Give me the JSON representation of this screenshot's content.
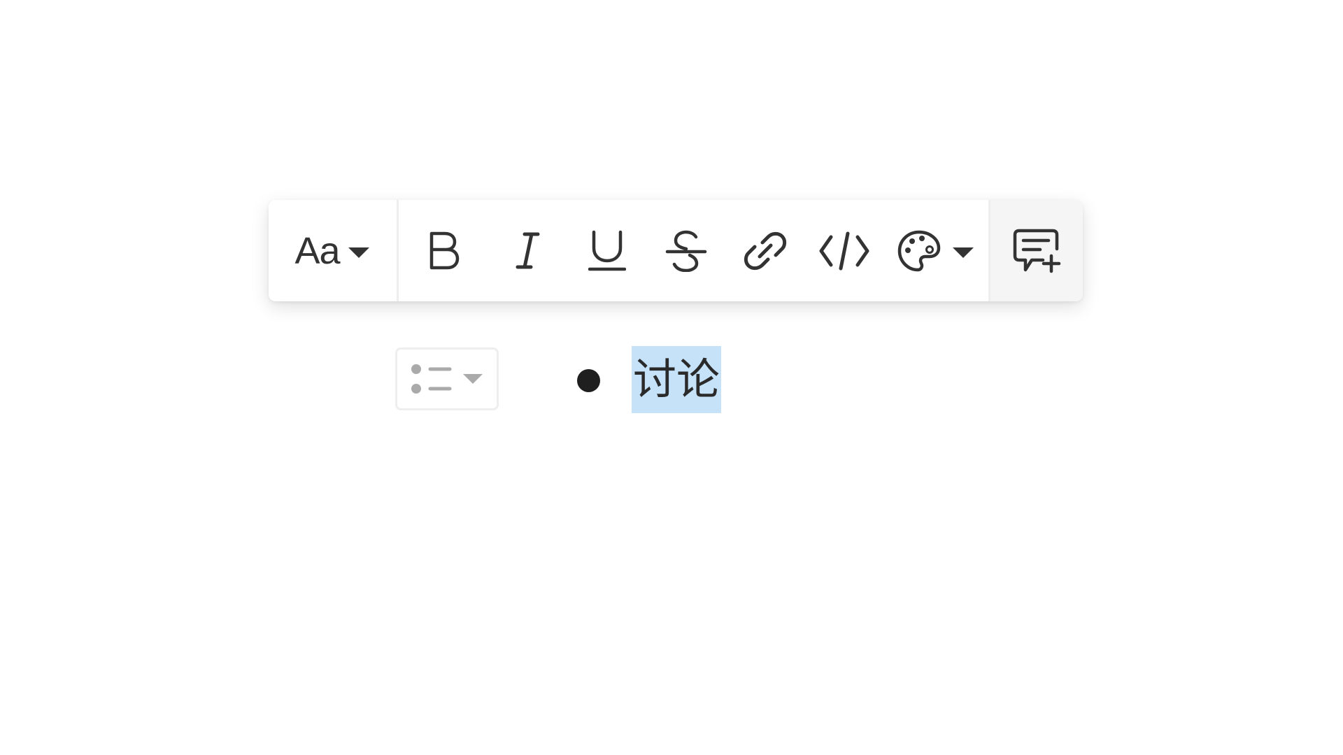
{
  "toolbar": {
    "font_button": {
      "label": "Aa",
      "icon": "caret-down-icon"
    },
    "format_buttons": [
      {
        "name": "bold",
        "icon": "bold-icon"
      },
      {
        "name": "italic",
        "icon": "italic-icon"
      },
      {
        "name": "underline",
        "icon": "underline-icon"
      },
      {
        "name": "strikethrough",
        "icon": "strikethrough-icon"
      },
      {
        "name": "link",
        "icon": "link-icon"
      },
      {
        "name": "code",
        "icon": "code-icon"
      }
    ],
    "color_button": {
      "icon": "palette-icon",
      "dropdown_icon": "caret-down-icon"
    },
    "comment_button": {
      "icon": "add-comment-icon"
    }
  },
  "editor": {
    "list_type_selector": {
      "icon": "bullet-list-icon",
      "dropdown_icon": "caret-down-icon"
    },
    "list_item": {
      "bullet": "•",
      "text": "讨论",
      "selected": true
    }
  },
  "colors": {
    "icon": "#333333",
    "selection": "#c5e2f9",
    "comment_bg": "#f5f5f5",
    "list_selector_icon": "#aaaaaa"
  }
}
